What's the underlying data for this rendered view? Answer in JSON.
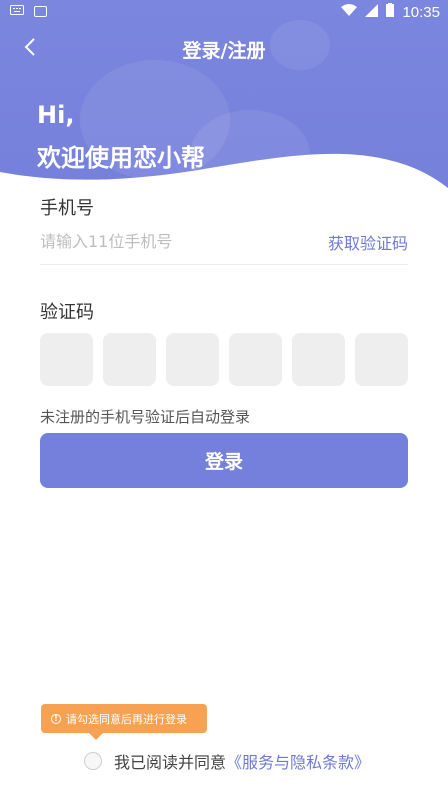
{
  "status_bar": {
    "time": "10:35",
    "icons": [
      "keyboard-icon",
      "a-notification-icon",
      "wifi-icon",
      "signal-icon",
      "battery-icon"
    ]
  },
  "nav": {
    "back_icon": "chevron-left-icon",
    "title": "登录/注册"
  },
  "greeting": {
    "line1": "Hi,",
    "line2": "欢迎使用恋小帮"
  },
  "phone": {
    "label": "手机号",
    "placeholder": "请输入11位手机号",
    "value": "",
    "get_code_label": "获取验证码"
  },
  "code": {
    "label": "验证码",
    "box_count": 6
  },
  "hint": "未注册的手机号验证后自动登录",
  "login_button": "登录",
  "tooltip": {
    "icon": "info-icon",
    "text": "请勾选同意后再进行登录"
  },
  "agreement": {
    "checked": false,
    "text": "我已阅读并同意",
    "link": "《服务与隐私条款》"
  },
  "colors": {
    "primary": "#7580dc",
    "link": "#6e79d6",
    "tooltip": "#f7a253",
    "code_box": "#eeeeee"
  }
}
